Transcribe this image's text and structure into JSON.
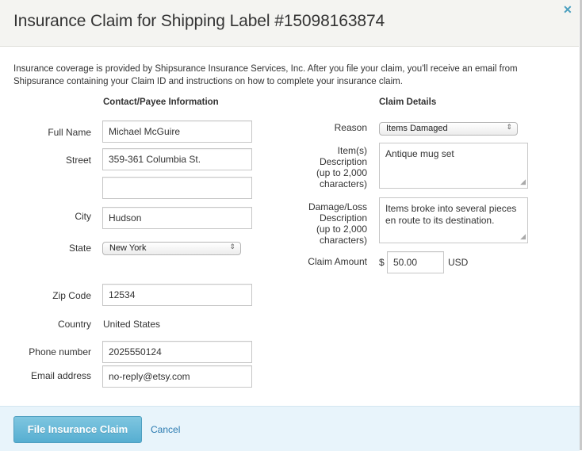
{
  "dialog": {
    "title": "Insurance Claim for Shipping Label #15098163874",
    "close_icon": "close-icon",
    "intro": "Insurance coverage is provided by Shipsurance Insurance Services, Inc. After you file your claim, you'll receive an email from Shipsurance containing your Claim ID and instructions on how to complete your insurance claim."
  },
  "contact": {
    "heading": "Contact/Payee Information",
    "full_name": {
      "label": "Full Name",
      "value": "Michael McGuire"
    },
    "street": {
      "label": "Street",
      "value": "359-361 Columbia St.",
      "value2": ""
    },
    "city": {
      "label": "City",
      "value": "Hudson"
    },
    "state": {
      "label": "State",
      "value": "New York"
    },
    "zip": {
      "label": "Zip Code",
      "value": "12534"
    },
    "country": {
      "label": "Country",
      "value": "United States"
    },
    "phone": {
      "label": "Phone number",
      "value": "2025550124"
    },
    "email": {
      "label": "Email address",
      "value": "no-reply@etsy.com"
    }
  },
  "claim": {
    "heading": "Claim Details",
    "reason": {
      "label": "Reason",
      "value": "Items Damaged"
    },
    "items_desc": {
      "label_lines": [
        "Item(s)",
        "Description",
        "(up to 2,000",
        "characters)"
      ],
      "value": "Antique mug set"
    },
    "damage_desc": {
      "label_lines": [
        "Damage/Loss",
        "Description",
        "(up to 2,000",
        "characters)"
      ],
      "value": "Items broke into several pieces en route to its destination."
    },
    "amount": {
      "label": "Claim Amount",
      "currency_symbol": "$",
      "value": "50.00",
      "currency": "USD"
    }
  },
  "footer": {
    "submit_label": "File Insurance Claim",
    "cancel_label": "Cancel"
  }
}
